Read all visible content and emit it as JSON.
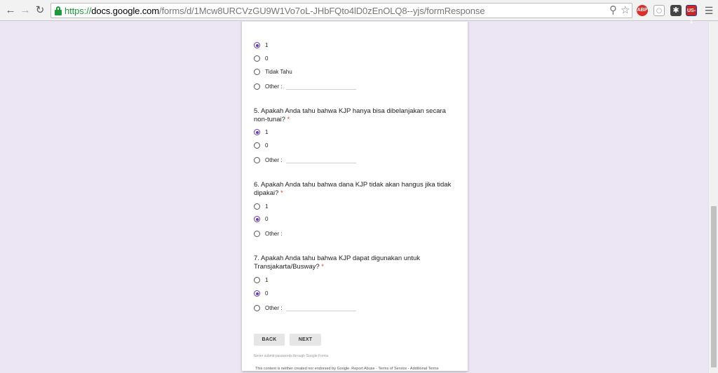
{
  "browser": {
    "url_scheme": "https://",
    "url_host": "docs.google.com",
    "url_path": "/forms/d/1Mcw8URCVzGU9W1Vo7oL-JHbFQto4lD0zEnOLQ8--yjs/formResponse",
    "extensions": [
      "ABP",
      "US-1"
    ]
  },
  "form": {
    "q4_options": [
      "1",
      "0",
      "Tidak Tahu",
      "Other :"
    ],
    "q5": {
      "text": "5. Apakah Anda tahu bahwa KJP hanya bisa dibelanjakan secara non-tunai?",
      "required_mark": "*",
      "options": [
        "1",
        "0",
        "Other :"
      ],
      "selected": "1"
    },
    "q6": {
      "text": "6. Apakah Anda tahu bahwa dana KJP tidak akan hangus jika tidak dipakai?",
      "required_mark": "*",
      "options": [
        "1",
        "0",
        "Other :"
      ],
      "selected": "0"
    },
    "q7": {
      "text": "7. Apakah Anda tahu bahwa KJP dapat digunakan untuk Transjakarta/Busway?",
      "required_mark": "*",
      "options": [
        "1",
        "0",
        "Other :"
      ],
      "selected": "0"
    },
    "back_label": "BACK",
    "next_label": "NEXT",
    "notice": "Never submit passwords through Google Forms."
  },
  "footer": {
    "text": "This content is neither created nor endorsed by Google. Report Abuse - Terms of Service - Additional Terms"
  },
  "colors": {
    "accent": "#673ab7",
    "page_bg": "#ece6f4",
    "required": "#db4437",
    "secure": "#1e9a3a"
  }
}
